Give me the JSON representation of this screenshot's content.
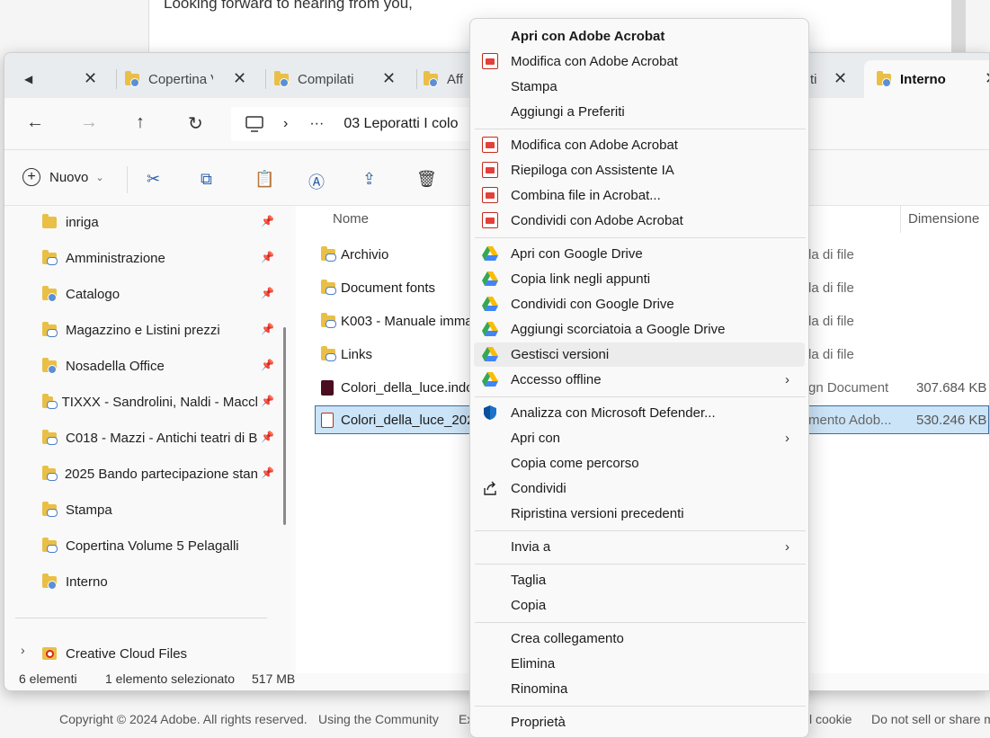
{
  "webpage": {
    "email_line": "Looking forward to hearing from you,",
    "footer": [
      "Copyright © 2024 Adobe. All rights reserved.",
      "Using the Community",
      "Ex",
      "l cookie",
      "Do not sell or share m"
    ]
  },
  "tabs": [
    {
      "label": "",
      "icon": "back-icon"
    },
    {
      "label": "Copertina V"
    },
    {
      "label": "Compilati"
    },
    {
      "label": "Aff"
    },
    {
      "label": "ti"
    },
    {
      "label": "Interno",
      "active": true
    }
  ],
  "address": {
    "path_ellipsis": "···",
    "folder": "03 Leporatti I colo"
  },
  "toolbar": {
    "new_label": "Nuovo",
    "icons": [
      "cut-icon",
      "copy-icon",
      "paste-icon",
      "rename-icon",
      "share-icon",
      "delete-icon"
    ]
  },
  "sidebar": {
    "items": [
      {
        "label": "inriga",
        "icon": "folder-icon",
        "pinned": true
      },
      {
        "label": "Amministrazione",
        "icon": "shared-folder-icon",
        "pinned": true
      },
      {
        "label": "Catalogo",
        "icon": "shared-folder-icon",
        "pinned": true
      },
      {
        "label": "Magazzino e Listini prezzi",
        "icon": "shared-folder-icon",
        "pinned": true
      },
      {
        "label": "Nosadella Office",
        "icon": "shared-folder-icon",
        "pinned": true
      },
      {
        "label": "TIXXX - Sandrolini, Naldi - Maccl",
        "icon": "shared-folder-icon",
        "pinned": true
      },
      {
        "label": "C018 - Mazzi - Antichi teatri di B",
        "icon": "shared-folder-icon",
        "pinned": true
      },
      {
        "label": "2025 Bando partecipazione stan",
        "icon": "shared-folder-icon",
        "pinned": true
      },
      {
        "label": "Stampa",
        "icon": "shared-folder-icon",
        "pinned": false
      },
      {
        "label": "Copertina Volume 5 Pelagalli",
        "icon": "shared-folder-icon",
        "pinned": false
      },
      {
        "label": "Interno",
        "icon": "shared-folder-icon",
        "pinned": false
      }
    ],
    "creative_cloud": "Creative Cloud Files"
  },
  "content": {
    "col_name": "Nome",
    "col_size": "Dimensione",
    "rows": [
      {
        "name": "Archivio",
        "type": "la di file",
        "size": ""
      },
      {
        "name": "Document fonts",
        "type": "la di file",
        "size": ""
      },
      {
        "name": "K003 - Manuale imma",
        "type": "la di file",
        "size": ""
      },
      {
        "name": "Links",
        "type": "la di file",
        "size": ""
      },
      {
        "name": "Colori_della_luce.indc",
        "type": "gn Document",
        "size": "307.684 KB"
      },
      {
        "name": "Colori_della_luce_202",
        "type": "mento Adob...",
        "size": "530.246 KB",
        "selected": true
      }
    ]
  },
  "status": {
    "count": "6 elementi",
    "selected": "1 elemento selezionato",
    "size": "517 MB"
  },
  "context_menu": {
    "groups": [
      [
        {
          "label": "Apri con Adobe Acrobat",
          "bold": true,
          "icon": ""
        },
        {
          "label": "Modifica con Adobe Acrobat",
          "icon": "acrobat-icon"
        },
        {
          "label": "Stampa",
          "icon": ""
        },
        {
          "label": "Aggiungi a Preferiti",
          "icon": ""
        }
      ],
      [
        {
          "label": "Modifica con Adobe Acrobat",
          "icon": "acrobat-icon"
        },
        {
          "label": "Riepiloga con Assistente IA",
          "icon": "acrobat-icon"
        },
        {
          "label": "Combina file in Acrobat...",
          "icon": "acrobat-icon"
        },
        {
          "label": "Condividi con Adobe Acrobat",
          "icon": "acrobat-icon"
        }
      ],
      [
        {
          "label": "Apri con Google Drive",
          "icon": "google-drive-icon"
        },
        {
          "label": "Copia link negli appunti",
          "icon": "google-drive-icon"
        },
        {
          "label": "Condividi con Google Drive",
          "icon": "google-drive-icon"
        },
        {
          "label": "Aggiungi scorciatoia a Google Drive",
          "icon": "google-drive-icon"
        },
        {
          "label": "Gestisci versioni",
          "icon": "google-drive-icon",
          "hover": true
        },
        {
          "label": "Accesso offline",
          "icon": "google-drive-icon",
          "submenu": true
        }
      ],
      [
        {
          "label": "Analizza con Microsoft Defender...",
          "icon": "defender-icon"
        },
        {
          "label": "Apri con",
          "icon": "",
          "submenu": true
        },
        {
          "label": "Copia come percorso",
          "icon": ""
        },
        {
          "label": "Condividi",
          "icon": "share-icon"
        },
        {
          "label": "Ripristina versioni precedenti",
          "icon": ""
        }
      ],
      [
        {
          "label": "Invia a",
          "icon": "",
          "submenu": true
        }
      ],
      [
        {
          "label": "Taglia",
          "icon": ""
        },
        {
          "label": "Copia",
          "icon": ""
        }
      ],
      [
        {
          "label": "Crea collegamento",
          "icon": ""
        },
        {
          "label": "Elimina",
          "icon": ""
        },
        {
          "label": "Rinomina",
          "icon": ""
        }
      ],
      [
        {
          "label": "Proprietà",
          "icon": ""
        }
      ]
    ]
  },
  "colors": {
    "accent": "#3a6ea5",
    "selection": "#cce4f7",
    "acrobat_red": "#c42b1c",
    "defender_blue": "#1a73c8"
  }
}
